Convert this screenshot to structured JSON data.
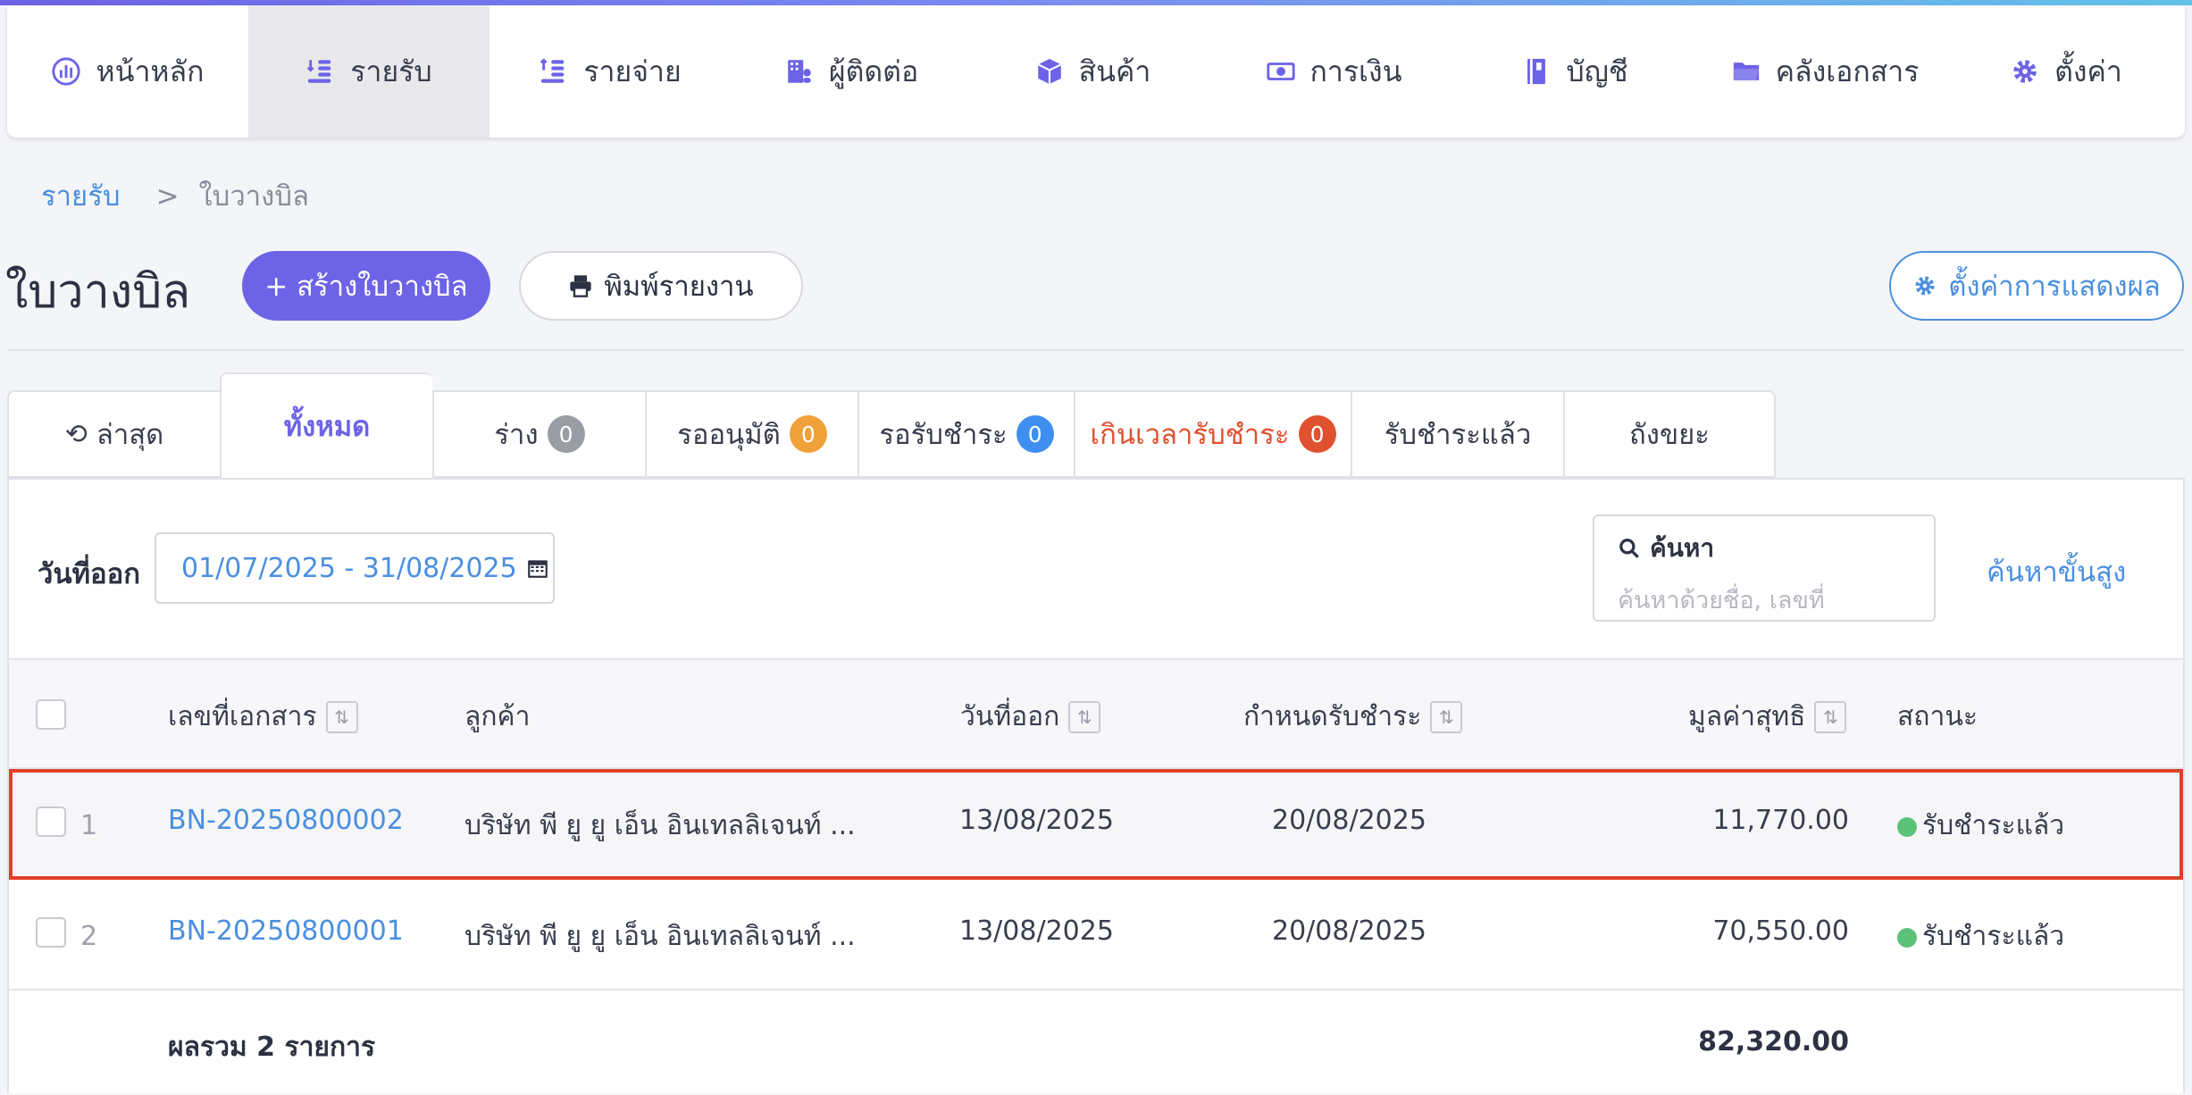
{
  "colors": {
    "accent": "#6c63e6",
    "link": "#4a8fe0",
    "warn": "#e0512f",
    "badge_gray": "#9a9ca6",
    "badge_orange": "#f0a13a",
    "badge_blue": "#3f8ff0",
    "badge_red": "#e0512f",
    "paid": "#5cc27a"
  },
  "nav": {
    "items": [
      {
        "label": "หน้าหลัก",
        "icon": "dashboard-gauge-icon"
      },
      {
        "label": "รายรับ",
        "icon": "income-coins-icon"
      },
      {
        "label": "รายจ่าย",
        "icon": "expense-coins-icon"
      },
      {
        "label": "ผู้ติดต่อ",
        "icon": "contacts-building-icon"
      },
      {
        "label": "สินค้า",
        "icon": "product-box-icon"
      },
      {
        "label": "การเงิน",
        "icon": "money-bill-icon"
      },
      {
        "label": "บัญชี",
        "icon": "ledger-book-icon"
      },
      {
        "label": "คลังเอกสาร",
        "icon": "folder-icon"
      },
      {
        "label": "ตั้งค่า",
        "icon": "gear-icon"
      }
    ]
  },
  "breadcrumb": {
    "parent": "รายรับ",
    "sep": ">",
    "current": "ใบวางบิล"
  },
  "page": {
    "title": "ใบวางบิล",
    "create_label": "+ สร้างใบวางบิล",
    "print_label": "พิมพ์รายงาน",
    "display_label": "ตั้งค่าการแสดงผล"
  },
  "tabs": {
    "recent": "ล่าสุด",
    "all": "ทั้งหมด",
    "draft": "ร่าง",
    "draft_count": "0",
    "pending": "รออนุมัติ",
    "pending_count": "0",
    "awaiting": "รอรับชำระ",
    "awaiting_count": "0",
    "overdue": "เกินเวลารับชำระ",
    "overdue_count": "0",
    "paid": "รับชำระแล้ว",
    "trash": "ถังขยะ"
  },
  "filter": {
    "date_label": "วันที่ออก",
    "date_range": "01/07/2025 - 31/08/2025",
    "search_label": "ค้นหา",
    "search_placeholder": "ค้นหาด้วยชื่อ, เลขที่",
    "advanced_label": "ค้นหาขั้นสูง"
  },
  "table": {
    "headers": {
      "doc": "เลขที่เอกสาร",
      "customer": "ลูกค้า",
      "issue": "วันที่ออก",
      "due": "กำหนดรับชำระ",
      "net": "มูลค่าสุทธิ",
      "status": "สถานะ"
    },
    "rows": [
      {
        "idx": "1",
        "doc": "BN-20250800002",
        "customer": "บริษัท พี ยู ยู เอ็น อินเทลลิเจนท์ ...",
        "issue": "13/08/2025",
        "due": "20/08/2025",
        "net": "11,770.00",
        "status": "รับชำระแล้ว"
      },
      {
        "idx": "2",
        "doc": "BN-20250800001",
        "customer": "บริษัท พี ยู ยู เอ็น อินเทลลิเจนท์ ...",
        "issue": "13/08/2025",
        "due": "20/08/2025",
        "net": "70,550.00",
        "status": "รับชำระแล้ว"
      }
    ],
    "total_label": "ผลรวม 2 รายการ",
    "total_value": "82,320.00"
  }
}
